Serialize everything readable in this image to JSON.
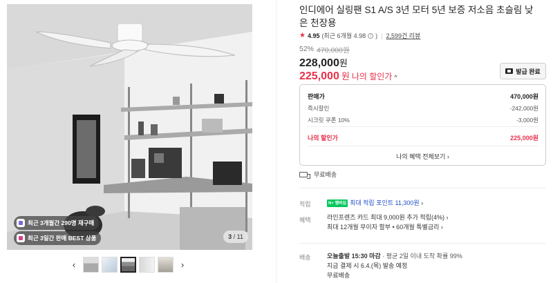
{
  "gallery": {
    "badges": [
      {
        "icon": "square-icon",
        "color": "#7a6bd8",
        "text": "최근 3개월간 290명 재구매"
      },
      {
        "icon": "square-icon",
        "color": "#d6408a",
        "text": "최근 3일간 판매 BEST 상품"
      }
    ],
    "counter": {
      "current": "3",
      "total": "/ 11"
    },
    "prev_icon": "‹",
    "next_icon": "›"
  },
  "product": {
    "title": "인디에어 실링팬 S1 A/S 3년 모터 5년 보증 저소음 초슬림 낮은 천장용",
    "rating": "4.95",
    "rating_recent": "(최근 6개월 4.98",
    "rating_recent_close": ")",
    "reviews": "2,599건 리뷰",
    "discount_pct": "52%",
    "original_price": "470,000원",
    "price": "228,000",
    "price_unit": "원",
    "my_price": "225,000",
    "my_price_unit": "원",
    "my_price_label": "나의 할인가",
    "coupon_button": "발급 완료"
  },
  "price_box": {
    "rows": [
      {
        "label": "판매가",
        "value": "470,000원"
      },
      {
        "label": "즉시할인",
        "value": "-242,000원"
      },
      {
        "label": "시크릿 쿠폰 10%",
        "value": "-3,000원"
      },
      {
        "label": "나의 할인가",
        "value": "225,000원"
      }
    ],
    "more": "나의 혜택 전체보기 ›"
  },
  "shipping_free": "무료배송",
  "points": {
    "label": "적립",
    "badge": "N+ 멤버십",
    "text": "최대 적립 포인트 11,300원",
    "chevron": "›"
  },
  "benefits": {
    "label": "혜택",
    "line1": "라인프렌즈 카드 최대 9,000원 추가 적립(4%) ›",
    "line2": "최대 12개월 무이자 할부 • 60개월 특별금리 ›"
  },
  "delivery": {
    "label": "배송",
    "line1_bold": "오늘출발 15:30 마감",
    "line1_rest": " · 평균 2일 이내 도착 확률 99%",
    "line2": "지금 결제 시 6.4.(목) 발송 예정",
    "line3": "무료배송"
  }
}
